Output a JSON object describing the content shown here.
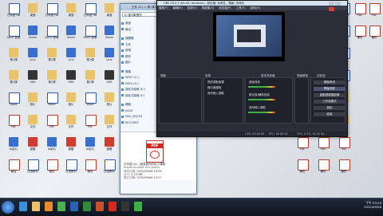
{
  "explorer": {
    "title": "文件 (E:) > 第1課 > 實作",
    "address": "E:\\第1課\\實作",
    "nav": [
      "桌面",
      "最近",
      "媒體櫃",
      "文件",
      "音樂",
      "視訊",
      "圖片",
      "電腦",
      "WIN7 (C:)",
      "DATA (D:)",
      "卸除式磁碟 (E:)",
      "卸除式磁碟 (F:)",
      "網路",
      "ASUS",
      "MAC_DS218",
      "RECOVER"
    ],
    "file": {
      "name": "日本語 Go – 圖書館內的私人課程",
      "type": "Adobe Acrobat Document",
      "rows": [
        {
          "k": "修改日期:",
          "v": "2022/09/06 15:29"
        },
        {
          "k": "大小:",
          "v": "1.23 MB"
        },
        {
          "k": "建立日期:",
          "v": "2022/09/06 15:27"
        }
      ],
      "thumb_label": "PDF"
    }
  },
  "obs": {
    "title": "OBS 28.0.1 (64-bit, windows) - 設定檔: 未命名 - 場景: 未命名",
    "menu": [
      "檔案(F)",
      "編輯(E)",
      "檢視(V)",
      "場景集(S)",
      "設定檔(P)",
      "工具(T)",
      "說明(H)"
    ],
    "panels": {
      "scenes": "場景",
      "sources": "來源",
      "mixer": "音效混音器",
      "transitions": "場景轉換",
      "controls": "控制項"
    },
    "sources": [
      "視訊擷取裝置",
      "顯示器擷取",
      "音訊輸入擷取"
    ],
    "mixer_channels": [
      "桌面音效",
      "麥克風/輔助音源",
      "音訊輸入擷取"
    ],
    "controls": [
      "開始串流",
      "開始錄影",
      "啟動虛擬攝影機",
      "工作室模式",
      "設定",
      "結束"
    ],
    "status": {
      "live": "LIVE: 00:00:00",
      "rec": "REC: 00:00:00",
      "cpu": "CPU: 4.3%, 30.00 fps"
    }
  },
  "desktop_icons": [
    {
      "label": "日本語 Go",
      "kind": "doc"
    },
    {
      "label": "AIGO 音樂",
      "kind": "doc"
    },
    {
      "label": "第1課",
      "kind": "folder"
    },
    {
      "label": "第2課",
      "kind": "folder"
    },
    {
      "label": "Word",
      "kind": "doc"
    },
    {
      "label": "PDF",
      "kind": "pdf"
    },
    {
      "label": "AI影片",
      "kind": "app"
    },
    {
      "label": "報告",
      "kind": "pdf"
    },
    {
      "label": "桌面",
      "kind": "folder"
    },
    {
      "label": "Zoom",
      "kind": "app"
    },
    {
      "label": "Line",
      "kind": "app"
    },
    {
      "label": "OBS",
      "kind": "dark"
    },
    {
      "label": "相片",
      "kind": "folder"
    },
    {
      "label": "文件",
      "kind": "folder"
    },
    {
      "label": "媒體",
      "kind": "red"
    },
    {
      "label": "日語教材",
      "kind": "doc"
    }
  ],
  "right_icons": [
    {
      "label": "安裝程式",
      "kind": "doc"
    },
    {
      "label": "課程",
      "kind": "doc"
    },
    {
      "label": "工作表",
      "kind": "doc"
    },
    {
      "label": "講義",
      "kind": "doc"
    },
    {
      "label": "記事",
      "kind": "yellow"
    },
    {
      "label": "雜項",
      "kind": "yellow"
    },
    {
      "label": "PDF",
      "kind": "pdf"
    },
    {
      "label": "備份",
      "kind": "pdf"
    }
  ],
  "taskbar": {
    "clock": "下午 03:29",
    "date": "2022/09/06",
    "icons": [
      "ie",
      "explorer",
      "media",
      "chrome",
      "word",
      "excel",
      "ppt",
      "pdf",
      "obs",
      "line"
    ]
  },
  "colors": {
    "obs_bg": "#2b2e38",
    "accent": "#3b6fcf",
    "pdf_red": "#d7281e"
  }
}
